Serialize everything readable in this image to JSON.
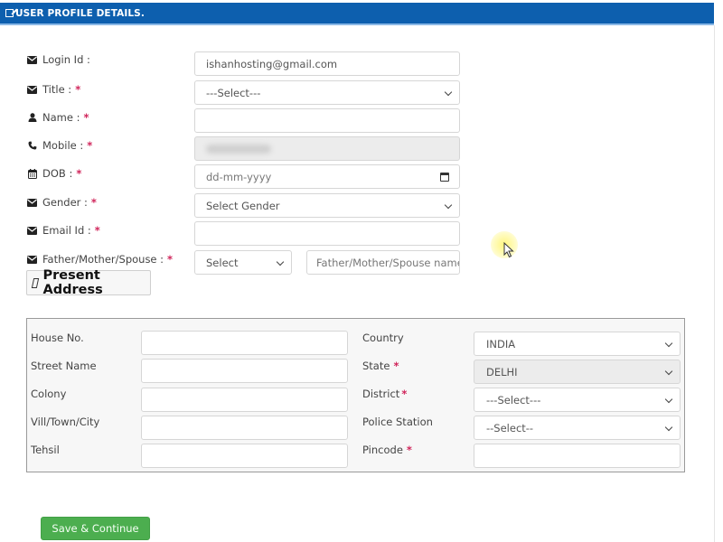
{
  "header": {
    "title": "USER PROFILE DETAILS.",
    "icon": "edit-icon"
  },
  "profile_form": {
    "login_id": {
      "label": "Login Id :",
      "icon": "envelope-icon",
      "value": "ishanhosting@gmail.com",
      "required": false
    },
    "title": {
      "label": "Title :",
      "icon": "envelope-icon",
      "selected": "---Select---",
      "required": true
    },
    "name": {
      "label": "Name :",
      "icon": "user-icon",
      "value": "",
      "required": true
    },
    "mobile": {
      "label": "Mobile :",
      "icon": "phone-icon",
      "value": "(blurred)",
      "required": true
    },
    "dob": {
      "label": "DOB :",
      "icon": "calendar-icon",
      "placeholder": "dd-mm-yyyy",
      "required": true
    },
    "gender": {
      "label": "Gender :",
      "icon": "envelope-icon",
      "selected": "Select Gender",
      "required": true
    },
    "email_id": {
      "label": "Email Id :",
      "icon": "envelope-icon",
      "value": "",
      "required": true
    },
    "relation": {
      "label": "Father/Mother/Spouse :",
      "icon": "envelope-icon",
      "selected": "Select",
      "name_placeholder": "Father/Mother/Spouse name",
      "required": true
    },
    "required_mark": "*"
  },
  "present_address": {
    "button_label": "Present Address",
    "left_fields": [
      {
        "label": "House No.",
        "value": ""
      },
      {
        "label": "Street Name",
        "value": ""
      },
      {
        "label": "Colony",
        "value": ""
      },
      {
        "label": "Vill/Town/City",
        "value": ""
      },
      {
        "label": "Tehsil",
        "value": ""
      }
    ],
    "right_fields": [
      {
        "label": "Country",
        "required": false,
        "type": "select",
        "selected": "INDIA"
      },
      {
        "label": "State",
        "required": true,
        "type": "select",
        "selected": "DELHI",
        "disabled": true
      },
      {
        "label": "District",
        "required": true,
        "type": "select",
        "selected": "---Select---"
      },
      {
        "label": "Police Station",
        "required": false,
        "type": "select",
        "selected": "--Select--"
      },
      {
        "label": "Pincode",
        "required": true,
        "type": "text",
        "value": ""
      }
    ]
  },
  "actions": {
    "save_label": "Save & Continue"
  },
  "colors": {
    "header_bg": "#0d5fae",
    "required": "#d0245a",
    "save_bg": "#4cae4f"
  }
}
